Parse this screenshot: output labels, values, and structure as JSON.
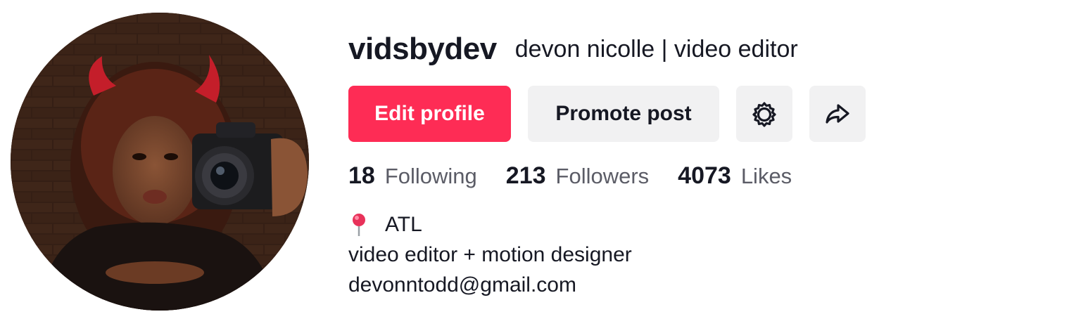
{
  "profile": {
    "username": "vidsbydev",
    "nickname": "devon nicolle | video editor"
  },
  "actions": {
    "edit_label": "Edit profile",
    "promote_label": "Promote post",
    "settings_icon": "gear-icon",
    "share_icon": "share-arrow-icon",
    "primary_color": "#fe2c55"
  },
  "stats": {
    "following": {
      "count": "18",
      "label": "Following"
    },
    "followers": {
      "count": "213",
      "label": "Followers"
    },
    "likes": {
      "count": "4073",
      "label": "Likes"
    }
  },
  "bio": {
    "location": "ATL",
    "location_icon": "pin-icon",
    "line1": "video editor + motion designer",
    "line2": "devonntodd@gmail.com"
  }
}
